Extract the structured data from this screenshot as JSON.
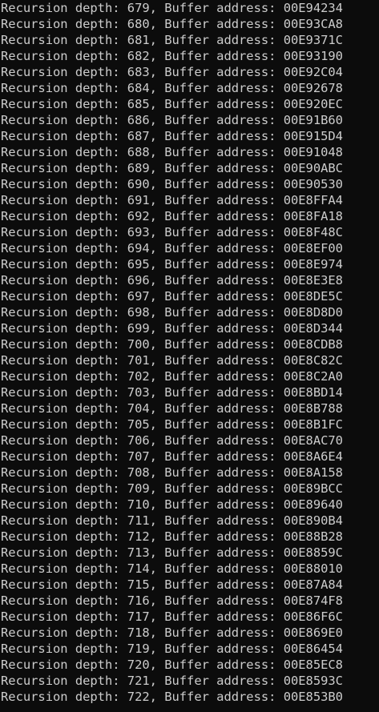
{
  "console": {
    "lines": [
      "Recursion depth: 679, Buffer address: 00E94234",
      "Recursion depth: 680, Buffer address: 00E93CA8",
      "Recursion depth: 681, Buffer address: 00E9371C",
      "Recursion depth: 682, Buffer address: 00E93190",
      "Recursion depth: 683, Buffer address: 00E92C04",
      "Recursion depth: 684, Buffer address: 00E92678",
      "Recursion depth: 685, Buffer address: 00E920EC",
      "Recursion depth: 686, Buffer address: 00E91B60",
      "Recursion depth: 687, Buffer address: 00E915D4",
      "Recursion depth: 688, Buffer address: 00E91048",
      "Recursion depth: 689, Buffer address: 00E90ABC",
      "Recursion depth: 690, Buffer address: 00E90530",
      "Recursion depth: 691, Buffer address: 00E8FFA4",
      "Recursion depth: 692, Buffer address: 00E8FA18",
      "Recursion depth: 693, Buffer address: 00E8F48C",
      "Recursion depth: 694, Buffer address: 00E8EF00",
      "Recursion depth: 695, Buffer address: 00E8E974",
      "Recursion depth: 696, Buffer address: 00E8E3E8",
      "Recursion depth: 697, Buffer address: 00E8DE5C",
      "Recursion depth: 698, Buffer address: 00E8D8D0",
      "Recursion depth: 699, Buffer address: 00E8D344",
      "Recursion depth: 700, Buffer address: 00E8CDB8",
      "Recursion depth: 701, Buffer address: 00E8C82C",
      "Recursion depth: 702, Buffer address: 00E8C2A0",
      "Recursion depth: 703, Buffer address: 00E8BD14",
      "Recursion depth: 704, Buffer address: 00E8B788",
      "Recursion depth: 705, Buffer address: 00E8B1FC",
      "Recursion depth: 706, Buffer address: 00E8AC70",
      "Recursion depth: 707, Buffer address: 00E8A6E4",
      "Recursion depth: 708, Buffer address: 00E8A158",
      "Recursion depth: 709, Buffer address: 00E89BCC",
      "Recursion depth: 710, Buffer address: 00E89640",
      "Recursion depth: 711, Buffer address: 00E890B4",
      "Recursion depth: 712, Buffer address: 00E88B28",
      "Recursion depth: 713, Buffer address: 00E8859C",
      "Recursion depth: 714, Buffer address: 00E88010",
      "Recursion depth: 715, Buffer address: 00E87A84",
      "Recursion depth: 716, Buffer address: 00E874F8",
      "Recursion depth: 717, Buffer address: 00E86F6C",
      "Recursion depth: 718, Buffer address: 00E869E0",
      "Recursion depth: 719, Buffer address: 00E86454",
      "Recursion depth: 720, Buffer address: 00E85EC8",
      "Recursion depth: 721, Buffer address: 00E8593C",
      "Recursion depth: 722, Buffer address: 00E853B0"
    ]
  },
  "colors": {
    "background": "#0c0c0c",
    "text": "#cccccc"
  }
}
